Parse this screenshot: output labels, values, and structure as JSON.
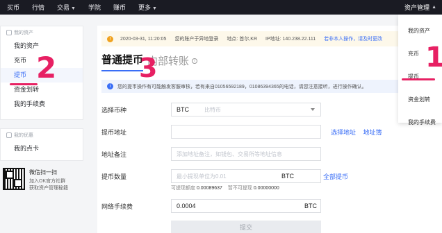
{
  "topnav": {
    "items": [
      "买币",
      "行情",
      "交易",
      "学院",
      "赚币",
      "更多"
    ],
    "asset_mgmt": "资产管理"
  },
  "sidebar": {
    "my_assets_header": "我的资产",
    "items": [
      "我的资产",
      "充币",
      "提币",
      "资金划转",
      "我的手续费"
    ],
    "active": "提币",
    "benefits_header": "我的优惠",
    "benefits_items": [
      "我的点卡"
    ]
  },
  "qr": {
    "title": "微信扫一扫",
    "line1": "加入OK官方社群",
    "line2": "获取资产管理秘籍"
  },
  "alert": {
    "time": "2020-03-31, 11:20:05",
    "msg": "您的账户于异地登录",
    "location_label": "地点: 首尔,KR",
    "ip_label": "IP地址: 140.238.22.111",
    "link": "若非本人操作，请及时更改"
  },
  "tabs": {
    "main": "普通提币",
    "sub": "内部转账"
  },
  "notice": "您的提币操作有可能触发客服审核，若有来自01056592189，01086394365的电话，请您注意接听，进行操作确认。",
  "form": {
    "coin_label": "选择币种",
    "coin_value": "BTC",
    "coin_sub": "比特币",
    "address_label": "提币地址",
    "select_address": "选择地址",
    "address_book": "地址簿",
    "remark_label": "地址备注",
    "remark_placeholder": "添加地址备注，如钱包、交易所等地址信息",
    "amount_label": "提币数量",
    "amount_placeholder": "最小提现单位为0.01",
    "amount_unit": "BTC",
    "withdraw_all": "全部提币",
    "avail_label": "可提现额度",
    "avail_value": "0.00089637",
    "frozen_label": "暂不可提现",
    "frozen_value": "0.00000000",
    "fee_label": "网络手续费",
    "fee_value": "0.0004",
    "fee_unit": "BTC",
    "submit": "提交"
  },
  "dropdown": {
    "items": [
      "我的资产",
      "充币",
      "提币",
      "资金划转",
      "我的手续费"
    ]
  },
  "annotations": {
    "n1": "1",
    "n2": "2",
    "n3": "3",
    "color": "#e72063"
  }
}
